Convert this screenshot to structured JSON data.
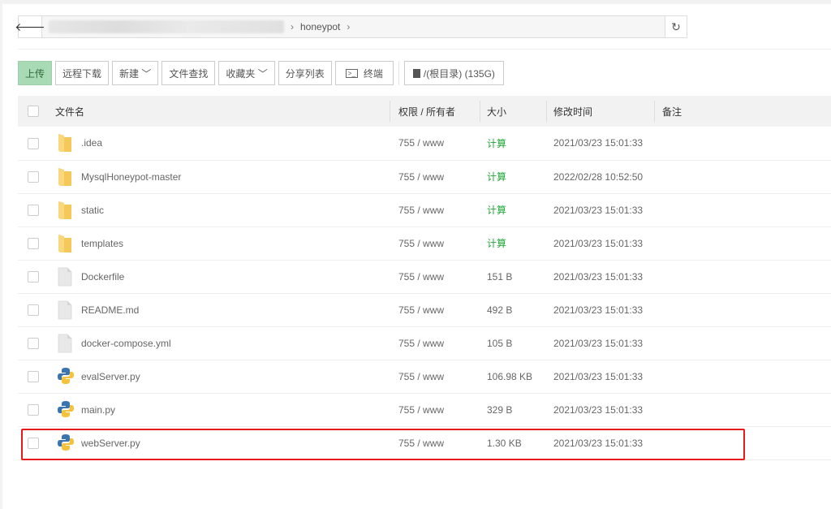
{
  "breadcrumb": {
    "current": "honeypot"
  },
  "toolbar": {
    "upload": "上传",
    "remote_download": "远程下载",
    "new": "新建",
    "file_search": "文件查找",
    "favorites": "收藏夹",
    "share_list": "分享列表",
    "terminal": "终端",
    "disk": "/(根目录) (135G)"
  },
  "table": {
    "headers": {
      "name": "文件名",
      "perm": "权限 / 所有者",
      "size": "大小",
      "mtime": "修改时间",
      "note": "备注"
    },
    "rows": [
      {
        "name": ".idea",
        "type": "folder",
        "perm": "755 / www",
        "size": "计算",
        "mtime": "2021/03/23 15:01:33"
      },
      {
        "name": "MysqlHoneypot-master",
        "type": "folder",
        "perm": "755 / www",
        "size": "计算",
        "mtime": "2022/02/28 10:52:50"
      },
      {
        "name": "static",
        "type": "folder",
        "perm": "755 / www",
        "size": "计算",
        "mtime": "2021/03/23 15:01:33"
      },
      {
        "name": "templates",
        "type": "folder",
        "perm": "755 / www",
        "size": "计算",
        "mtime": "2021/03/23 15:01:33"
      },
      {
        "name": "Dockerfile",
        "type": "file",
        "perm": "755 / www",
        "size": "151 B",
        "mtime": "2021/03/23 15:01:33"
      },
      {
        "name": "README.md",
        "type": "file",
        "perm": "755 / www",
        "size": "492 B",
        "mtime": "2021/03/23 15:01:33"
      },
      {
        "name": "docker-compose.yml",
        "type": "file",
        "perm": "755 / www",
        "size": "105 B",
        "mtime": "2021/03/23 15:01:33"
      },
      {
        "name": "evalServer.py",
        "type": "python",
        "perm": "755 / www",
        "size": "106.98 KB",
        "mtime": "2021/03/23 15:01:33"
      },
      {
        "name": "main.py",
        "type": "python",
        "perm": "755 / www",
        "size": "329 B",
        "mtime": "2021/03/23 15:01:33"
      },
      {
        "name": "webServer.py",
        "type": "python",
        "perm": "755 / www",
        "size": "1.30 KB",
        "mtime": "2021/03/23 15:01:33"
      }
    ]
  },
  "colors": {
    "highlight": "#e8191b",
    "calc": "#20a53a",
    "upload_bg": "#a8dbb5"
  }
}
